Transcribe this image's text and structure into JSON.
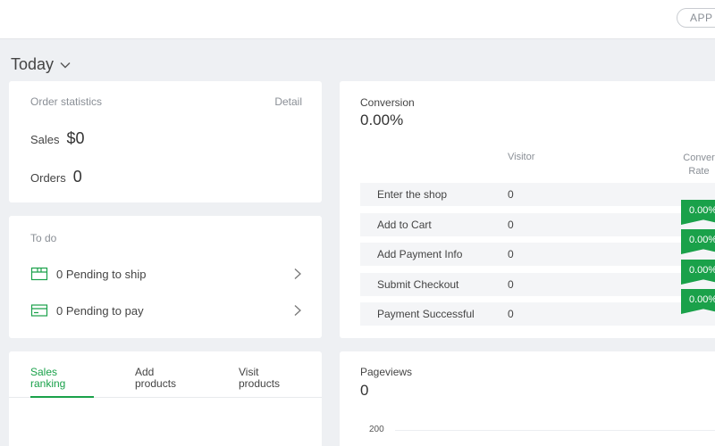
{
  "topbar": {
    "app_button_label": "APP"
  },
  "period": {
    "label": "Today"
  },
  "order_statistics": {
    "title": "Order statistics",
    "detail_link": "Detail",
    "sales_label": "Sales",
    "sales_value": "$0",
    "orders_label": "Orders",
    "orders_value": "0"
  },
  "todo": {
    "title": "To do",
    "items": [
      {
        "label": "0 Pending to ship",
        "icon": "package-icon"
      },
      {
        "label": "0 Pending to pay",
        "icon": "card-icon"
      }
    ]
  },
  "ranking_tabs": {
    "tabs": [
      {
        "label_line1": "Sales",
        "label_line2": "ranking",
        "active": true
      },
      {
        "label_line1": "Add",
        "label_line2": "products",
        "active": false
      },
      {
        "label_line1": "Visit",
        "label_line2": "products",
        "active": false
      }
    ]
  },
  "conversion": {
    "title": "Conversion",
    "value": "0.00%",
    "header_visitor": "Visitor",
    "header_rate_line1": "Conver",
    "header_rate_line2": "Rate",
    "rows": [
      {
        "stage": "Enter the shop",
        "visitors": "0"
      },
      {
        "stage": "Add to Cart",
        "visitors": "0"
      },
      {
        "stage": "Add Payment Info",
        "visitors": "0"
      },
      {
        "stage": "Submit Checkout",
        "visitors": "0"
      },
      {
        "stage": "Payment Successful",
        "visitors": "0"
      }
    ],
    "rate_badges": [
      "0.00%",
      "0.00%",
      "0.00%",
      "0.00%"
    ]
  },
  "pageviews": {
    "title": "Pageviews",
    "value": "0",
    "y_tick": "200"
  },
  "colors": {
    "accent": "#1aa14a",
    "background": "#eef0f3"
  }
}
